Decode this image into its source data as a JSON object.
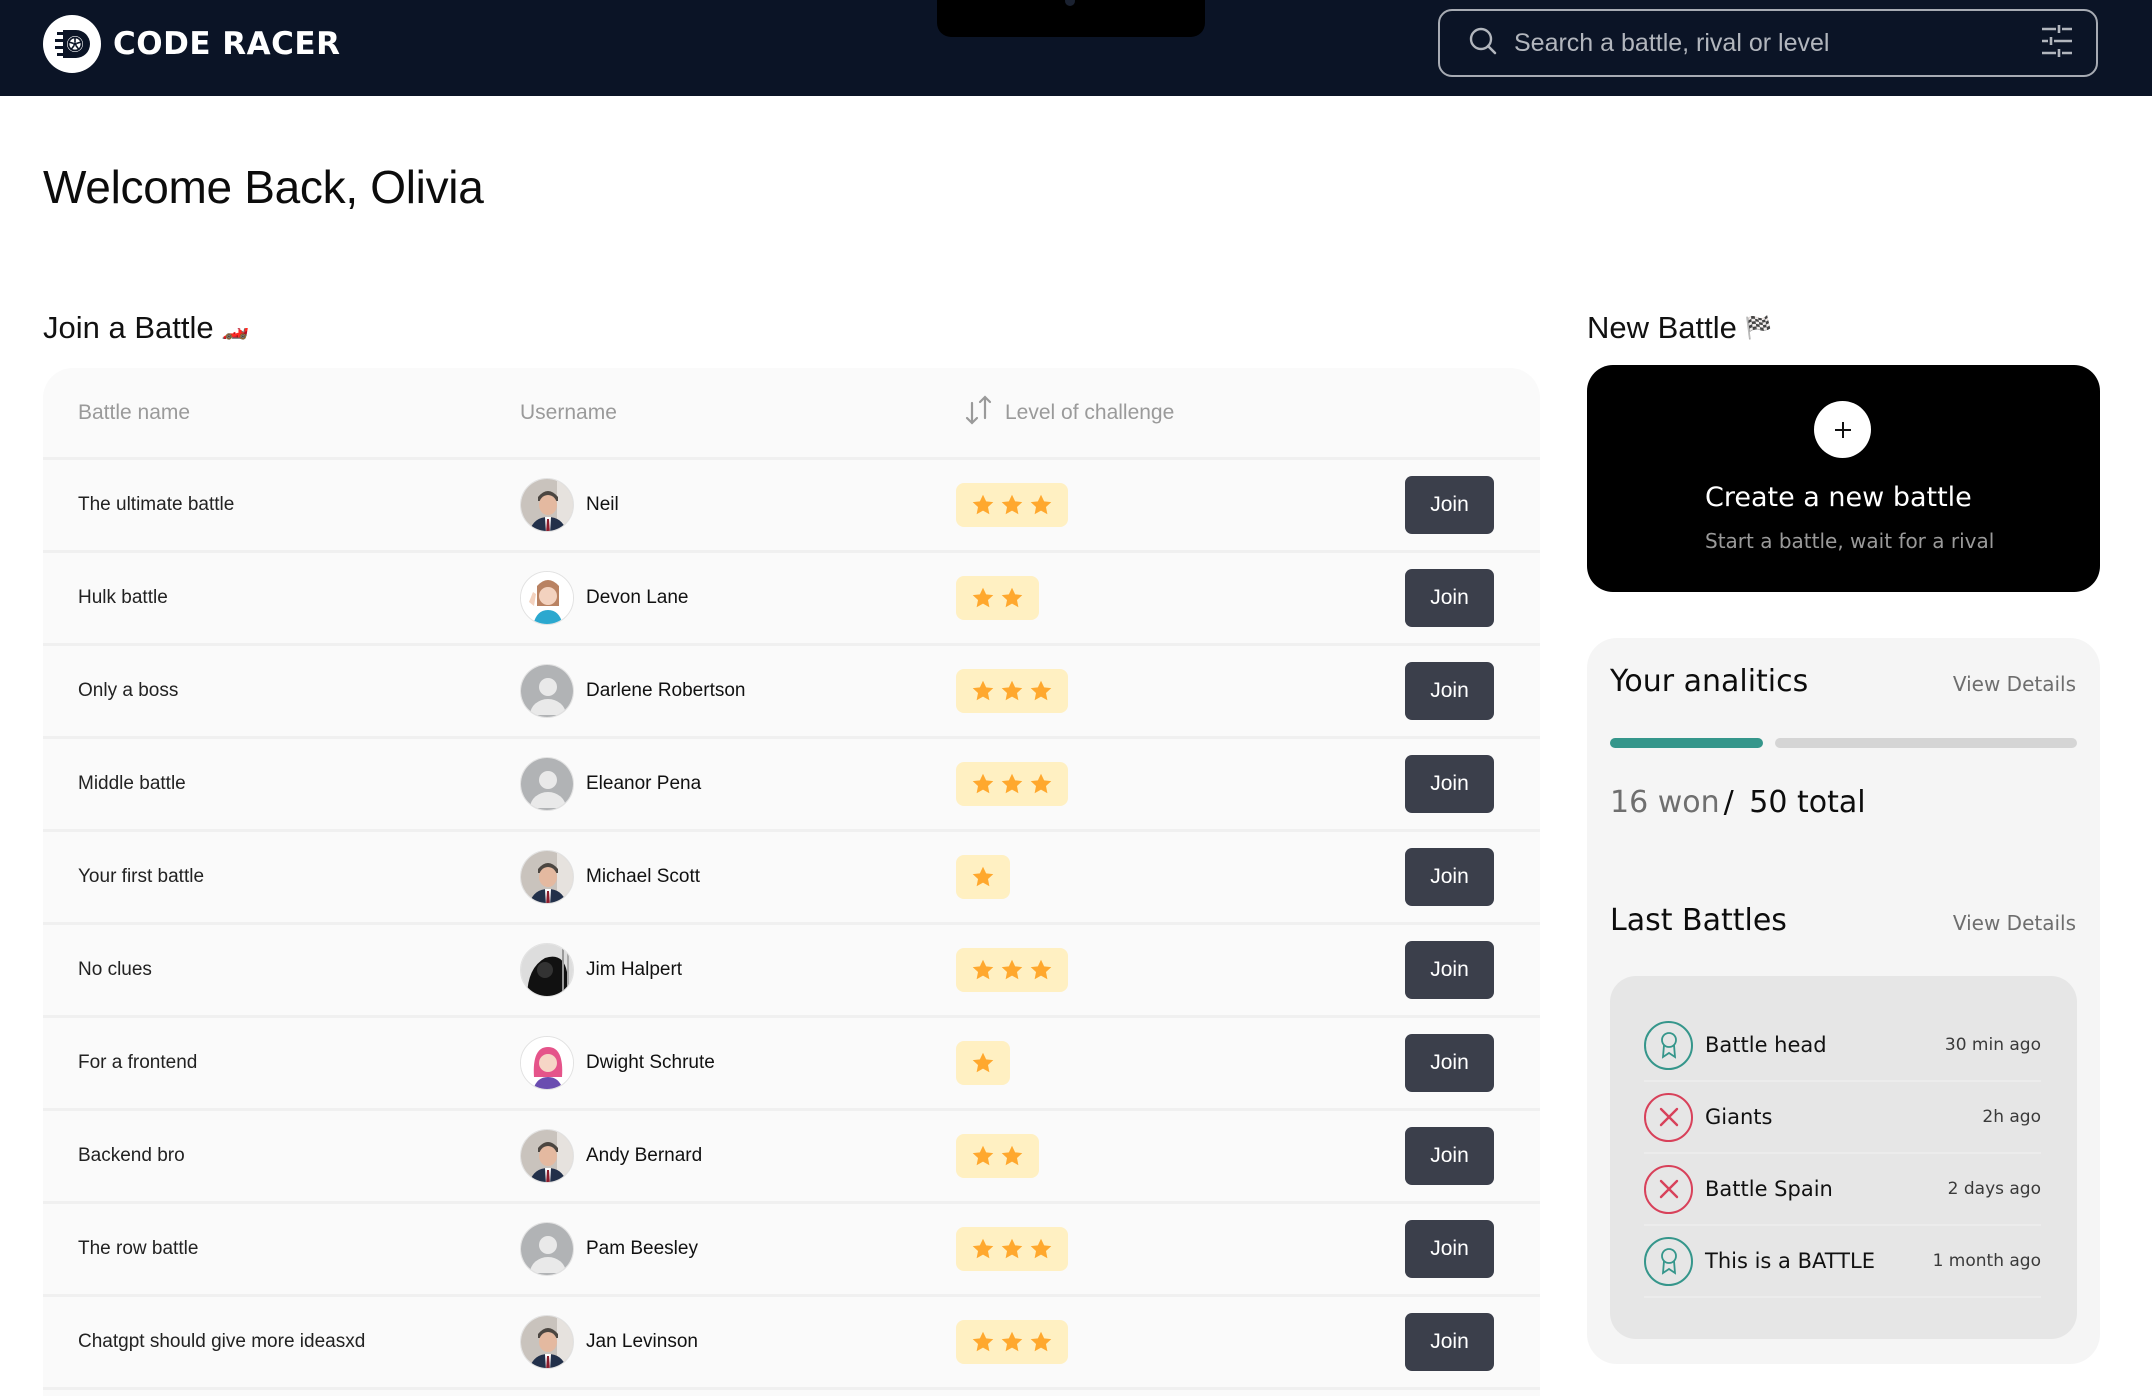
{
  "header": {
    "app_name": "CODE RACER",
    "logo_icon": "wheel-logo-icon",
    "search": {
      "placeholder": "Search a battle, rival or level",
      "value": "",
      "search_icon": "search-icon",
      "filter_icon": "sliders-icon"
    }
  },
  "welcome": {
    "title": "Welcome Back, Olivia"
  },
  "join_section": {
    "title": "Join a Battle",
    "title_emoji": "🏎️",
    "columns": {
      "battle_name": "Battle name",
      "username": "Username",
      "level": "Level of challenge",
      "level_icon": "sort-arrows-icon"
    },
    "join_label": "Join",
    "rows": [
      {
        "battle": "The ultimate battle",
        "username": "Neil",
        "avatar": "photo",
        "level": 3
      },
      {
        "battle": "Hulk battle",
        "username": "Devon Lane",
        "avatar": "memoji-waving",
        "level": 2
      },
      {
        "battle": "Only a boss",
        "username": "Darlene Robertson",
        "avatar": "placeholder",
        "level": 3
      },
      {
        "battle": "Middle battle",
        "username": "Eleanor Pena",
        "avatar": "placeholder",
        "level": 3
      },
      {
        "battle": "Your first battle",
        "username": "Michael Scott",
        "avatar": "photo",
        "level": 1
      },
      {
        "battle": "No clues",
        "username": "Jim Halpert",
        "avatar": "bw-photo",
        "level": 3
      },
      {
        "battle": "For a frontend",
        "username": "Dwight Schrute",
        "avatar": "memoji-pink",
        "level": 1
      },
      {
        "battle": "Backend bro",
        "username": "Andy Bernard",
        "avatar": "photo",
        "level": 2
      },
      {
        "battle": "The row battle",
        "username": "Pam Beesley",
        "avatar": "placeholder",
        "level": 3
      },
      {
        "battle": "Chatgpt should give more ideasxd",
        "username": "Jan Levinson",
        "avatar": "photo",
        "level": 3
      }
    ]
  },
  "new_battle": {
    "title": "New Battle",
    "title_emoji": "🏁",
    "card_title": "Create a new battle",
    "card_subtitle": "Start a battle, wait for a rival",
    "plus_icon": "plus-icon"
  },
  "analytics": {
    "title": "Your analitics",
    "view_details": "View Details",
    "won": 16,
    "total": 50,
    "won_label": "16 won",
    "separator": "/",
    "total_label": "50 total",
    "progress_fraction": 0.32,
    "colors": {
      "won": "#35968b",
      "rest": "#d5d5d5"
    }
  },
  "last_battles": {
    "title": "Last Battles",
    "view_details": "View Details",
    "items": [
      {
        "name": "Battle head",
        "time": "30 min ago",
        "result": "win"
      },
      {
        "name": "Giants",
        "time": "2h ago",
        "result": "loss"
      },
      {
        "name": "Battle Spain",
        "time": "2 days ago",
        "result": "loss"
      },
      {
        "name": "This is a BATTLE",
        "time": "1 month ago",
        "result": "win"
      }
    ],
    "colors": {
      "win": "#35968b",
      "loss": "#d8415a"
    }
  },
  "colors": {
    "header_bg": "#0b1426",
    "join_button": "#3b3f4b",
    "star": "#ffa82e",
    "star_badge_bg": "#fff0c2"
  }
}
